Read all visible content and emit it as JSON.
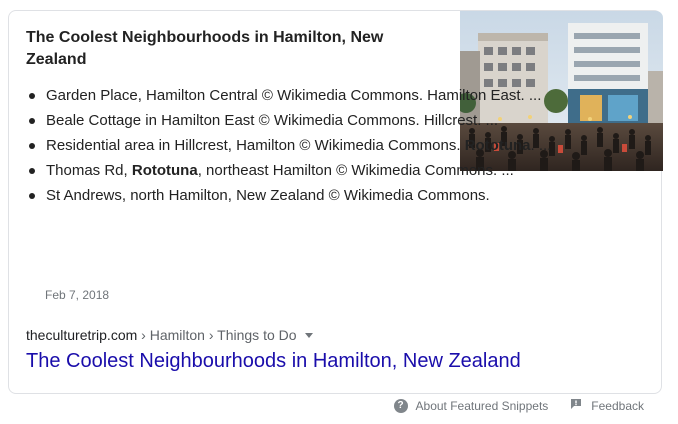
{
  "snippet": {
    "heading": "The Coolest Neighbourhoods in Hamilton, New Zealand",
    "image_alt": "Garden Place, Hamilton Central",
    "bullets": [
      {
        "parts": [
          {
            "text": "Garden Place, Hamilton Central © Wikimedia Commons. Hamilton East. ...",
            "bold": false
          }
        ]
      },
      {
        "parts": [
          {
            "text": "Beale Cottage in Hamilton East © Wikimedia Commons. Hillcrest. ...",
            "bold": false
          }
        ]
      },
      {
        "parts": [
          {
            "text": "Residential area in Hillcrest, Hamilton © Wikimedia Commons. ",
            "bold": false
          },
          {
            "text": "Rototuna",
            "bold": true
          },
          {
            "text": ". ...",
            "bold": false
          }
        ]
      },
      {
        "parts": [
          {
            "text": "Thomas Rd, ",
            "bold": false
          },
          {
            "text": "Rototuna",
            "bold": true
          },
          {
            "text": ", northeast Hamilton © Wikimedia Commons. ...",
            "bold": false
          }
        ]
      },
      {
        "parts": [
          {
            "text": "St Andrews, north Hamilton, New Zealand © Wikimedia Commons.",
            "bold": false
          }
        ]
      }
    ],
    "date": "Feb 7, 2018",
    "breadcrumb": {
      "domain": "theculturetrip.com",
      "path": " › Hamilton › Things to Do"
    },
    "result_title": "The Coolest Neighbourhoods in Hamilton, New Zealand"
  },
  "footer": {
    "about_label": "About Featured Snippets",
    "feedback_label": "Feedback"
  },
  "colors": {
    "link": "#1a0dab",
    "muted": "#70757a",
    "border": "#dfe1e5"
  },
  "icons": {
    "about": "question-circle-icon",
    "feedback": "feedback-flag-icon",
    "menu": "caret-down-icon"
  }
}
